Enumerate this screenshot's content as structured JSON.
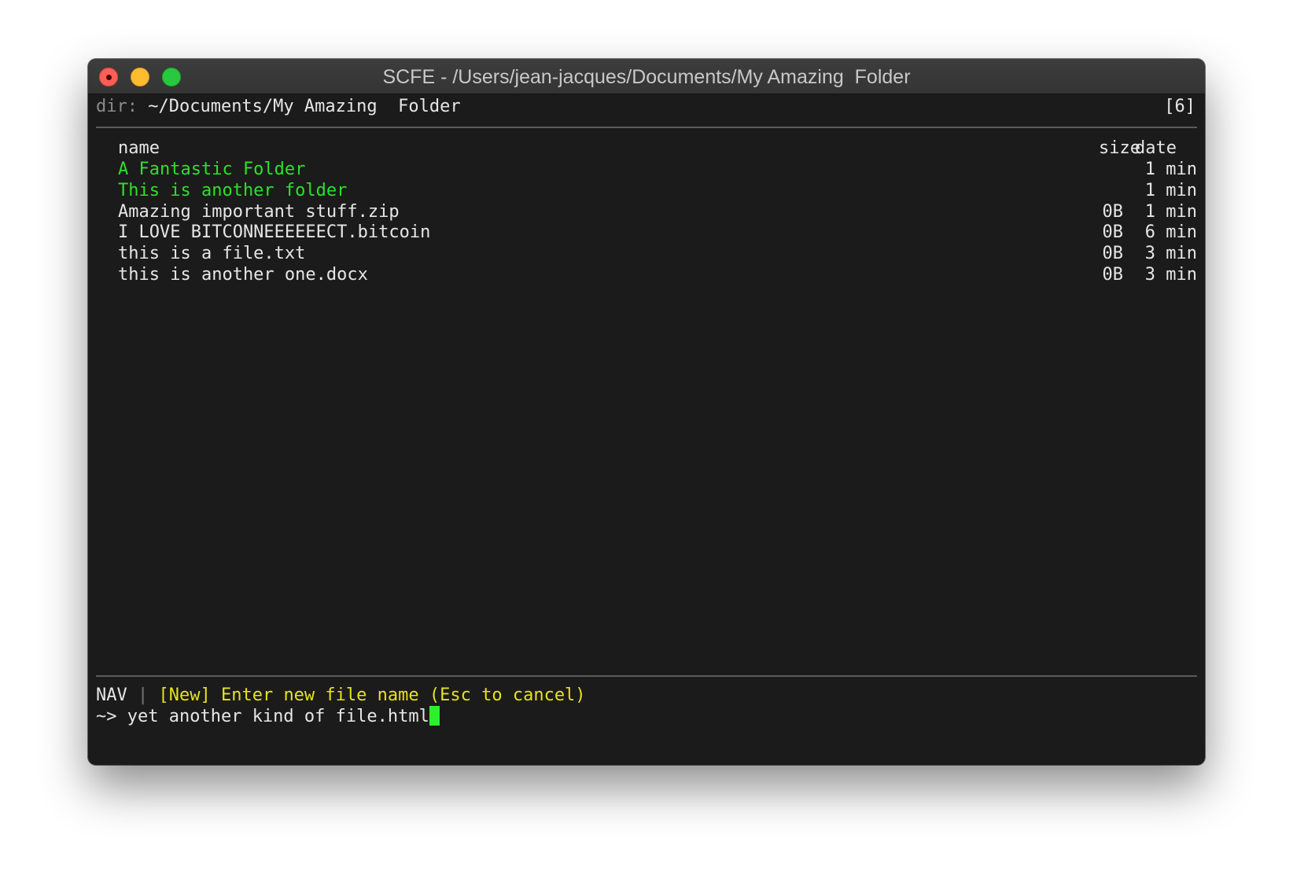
{
  "window": {
    "title": "SCFE - /Users/jean-jacques/Documents/My Amazing  Folder"
  },
  "header": {
    "dir_prefix": "dir:",
    "dir_path": " ~/Documents/My Amazing  Folder",
    "item_count": "[6]"
  },
  "columns": {
    "name": "name",
    "size": "size",
    "date": "date"
  },
  "rows": [
    {
      "name": "A Fantastic Folder",
      "size": "",
      "date": "1 min",
      "type": "folder"
    },
    {
      "name": "This is another folder",
      "size": "",
      "date": "1 min",
      "type": "folder"
    },
    {
      "name": "Amazing important stuff.zip",
      "size": "0B",
      "date": "1 min",
      "type": "file"
    },
    {
      "name": "I LOVE BITCONNEEEEEECT.bitcoin",
      "size": "0B",
      "date": "6 min",
      "type": "file"
    },
    {
      "name": "this is a file.txt",
      "size": "0B",
      "date": "3 min",
      "type": "file"
    },
    {
      "name": "this is another one.docx",
      "size": "0B",
      "date": "3 min",
      "type": "file"
    }
  ],
  "status": {
    "mode": "NAV",
    "separator": "|",
    "notice": "[New] Enter new file name (Esc to cancel)"
  },
  "prompt": {
    "symbol": "~>",
    "input_value": "yet another kind of file.html"
  },
  "colors": {
    "background": "#1b1b1b",
    "folder": "#2ce02c",
    "notice": "#e6e21c",
    "cursor": "#2cf02c"
  },
  "icons": [
    "close-button-icon",
    "minimize-button-icon",
    "zoom-button-icon"
  ]
}
